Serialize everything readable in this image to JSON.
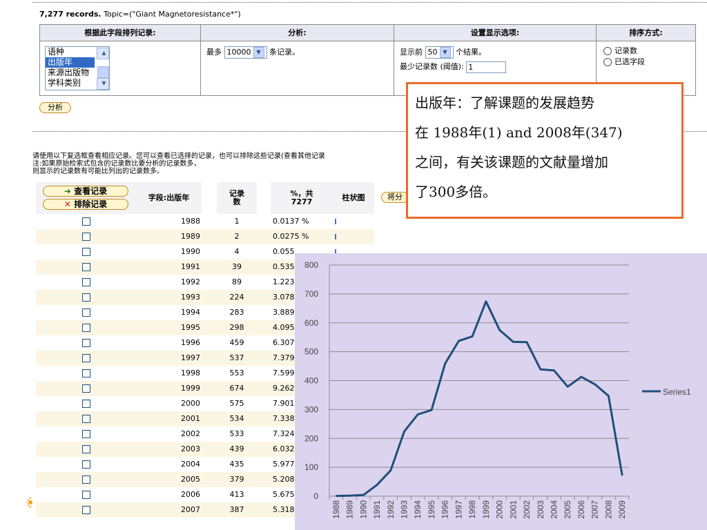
{
  "summary": {
    "count_label": "7,277 records.",
    "topic_text": " Topic=(\"Giant Magnetoresistance*\")"
  },
  "options": {
    "headers": [
      "根据此字段排列记录:",
      "分析:",
      "设置显示选项:",
      "排序方式:"
    ],
    "field_list": {
      "items": [
        "语种",
        "出版年",
        "来源出版物",
        "学科类别"
      ],
      "selected": "出版年"
    },
    "analyze": {
      "prefix": "最多",
      "value": "10000",
      "suffix": "条记录。"
    },
    "display": {
      "show_prefix": "显示前",
      "show_value": "50",
      "show_suffix": "个结果。",
      "min_label": "最少记录数 (阈值):",
      "min_value": "1"
    },
    "sort": {
      "option1": "记录数",
      "option2": "已选字段"
    }
  },
  "analyze_button": "分析",
  "callout": {
    "lines": [
      "出版年：了解课题的发展趋势",
      "在 1988年(1) and 2008年(347)",
      "之间，有关该课题的文献量增加",
      "了300多倍。"
    ]
  },
  "note": {
    "line1": "请使用以下复选框查看相应记录。您可以查看已选择的记录，也可以排除这些记录(查看其他记录",
    "line2": "注:如果原始检索式包含的记录数比要分析的记录数多，",
    "line3": "则显示的记录数有可能比列出的记录数多。"
  },
  "results": {
    "view_button": "查看记录",
    "exclude_button": "排除记录",
    "col_field": "字段:出版年",
    "col_count": "记录\n数",
    "col_pct": "%，共\n7277",
    "col_bar": "柱状图",
    "save_button": "将分",
    "rows": [
      {
        "year": "1988",
        "count": "1",
        "pct": "0.0137 %"
      },
      {
        "year": "1989",
        "count": "2",
        "pct": "0.0275 %"
      },
      {
        "year": "1990",
        "count": "4",
        "pct": "0.055"
      },
      {
        "year": "1991",
        "count": "39",
        "pct": "0.535"
      },
      {
        "year": "1992",
        "count": "89",
        "pct": "1.223"
      },
      {
        "year": "1993",
        "count": "224",
        "pct": "3.078"
      },
      {
        "year": "1994",
        "count": "283",
        "pct": "3.889"
      },
      {
        "year": "1995",
        "count": "298",
        "pct": "4.095"
      },
      {
        "year": "1996",
        "count": "459",
        "pct": "6.307"
      },
      {
        "year": "1997",
        "count": "537",
        "pct": "7.379"
      },
      {
        "year": "1998",
        "count": "553",
        "pct": "7.599"
      },
      {
        "year": "1999",
        "count": "674",
        "pct": "9.262"
      },
      {
        "year": "2000",
        "count": "575",
        "pct": "7.901"
      },
      {
        "year": "2001",
        "count": "534",
        "pct": "7.338"
      },
      {
        "year": "2002",
        "count": "533",
        "pct": "7.324"
      },
      {
        "year": "2003",
        "count": "439",
        "pct": "6.032"
      },
      {
        "year": "2004",
        "count": "435",
        "pct": "5.977"
      },
      {
        "year": "2005",
        "count": "379",
        "pct": "5.208"
      },
      {
        "year": "2006",
        "count": "413",
        "pct": "5.675"
      },
      {
        "year": "2007",
        "count": "387",
        "pct": "5.318"
      }
    ]
  },
  "chart_data": {
    "type": "line",
    "x": [
      "1988",
      "1989",
      "1990",
      "1991",
      "1992",
      "1993",
      "1994",
      "1995",
      "1996",
      "1997",
      "1998",
      "1999",
      "2000",
      "2001",
      "2002",
      "2003",
      "2004",
      "2005",
      "2006",
      "2007",
      "2008",
      "2009"
    ],
    "series": [
      {
        "name": "Series1",
        "values": [
          1,
          2,
          4,
          39,
          89,
          224,
          283,
          298,
          459,
          537,
          553,
          674,
          575,
          534,
          533,
          439,
          435,
          379,
          413,
          387,
          347,
          73
        ]
      }
    ],
    "ylim": [
      0,
      800
    ],
    "yticks": [
      0,
      100,
      200,
      300,
      400,
      500,
      600,
      700,
      800
    ],
    "grid": true,
    "legend": "right",
    "line_color": "#1f4e79",
    "background": "#dcd3ef"
  },
  "colors": {
    "header_bg": "#e7e8f1",
    "callout_border": "#e86a2a",
    "row_alt": "#fbf6e3",
    "select": "#316ac5"
  },
  "icons": {
    "analyze_arrow": "arrow-right-icon",
    "exclude": "x-icon"
  }
}
